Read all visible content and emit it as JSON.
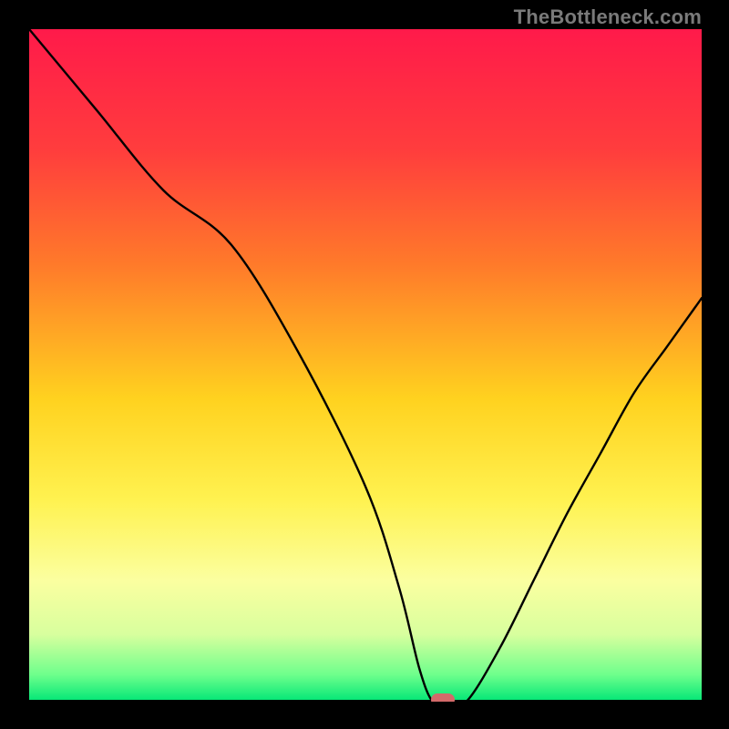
{
  "watermark": "TheBottleneck.com",
  "chart_data": {
    "type": "line",
    "title": "",
    "xlabel": "",
    "ylabel": "",
    "xlim": [
      0,
      100
    ],
    "ylim": [
      0,
      100
    ],
    "curve": {
      "x": [
        0,
        10,
        20,
        30,
        40,
        50,
        55,
        58,
        60,
        62,
        65,
        70,
        75,
        80,
        85,
        90,
        95,
        100
      ],
      "y": [
        100,
        88,
        76,
        68,
        52,
        32,
        17,
        5,
        0,
        0,
        0,
        8,
        18,
        28,
        37,
        46,
        53,
        60
      ]
    },
    "optimal_zone": {
      "x_start": 58,
      "x_end": 65,
      "y": 0
    },
    "marker": {
      "x": 61.5,
      "y": 0,
      "color": "#d36a6a"
    },
    "gradient_stops": [
      {
        "offset": 0,
        "color": "#ff1a4a"
      },
      {
        "offset": 18,
        "color": "#ff3d3d"
      },
      {
        "offset": 35,
        "color": "#ff7a2a"
      },
      {
        "offset": 55,
        "color": "#ffd21f"
      },
      {
        "offset": 70,
        "color": "#fff250"
      },
      {
        "offset": 82,
        "color": "#fbffa0"
      },
      {
        "offset": 90,
        "color": "#d8ff9e"
      },
      {
        "offset": 96,
        "color": "#6eff8c"
      },
      {
        "offset": 100,
        "color": "#00e676"
      }
    ]
  }
}
